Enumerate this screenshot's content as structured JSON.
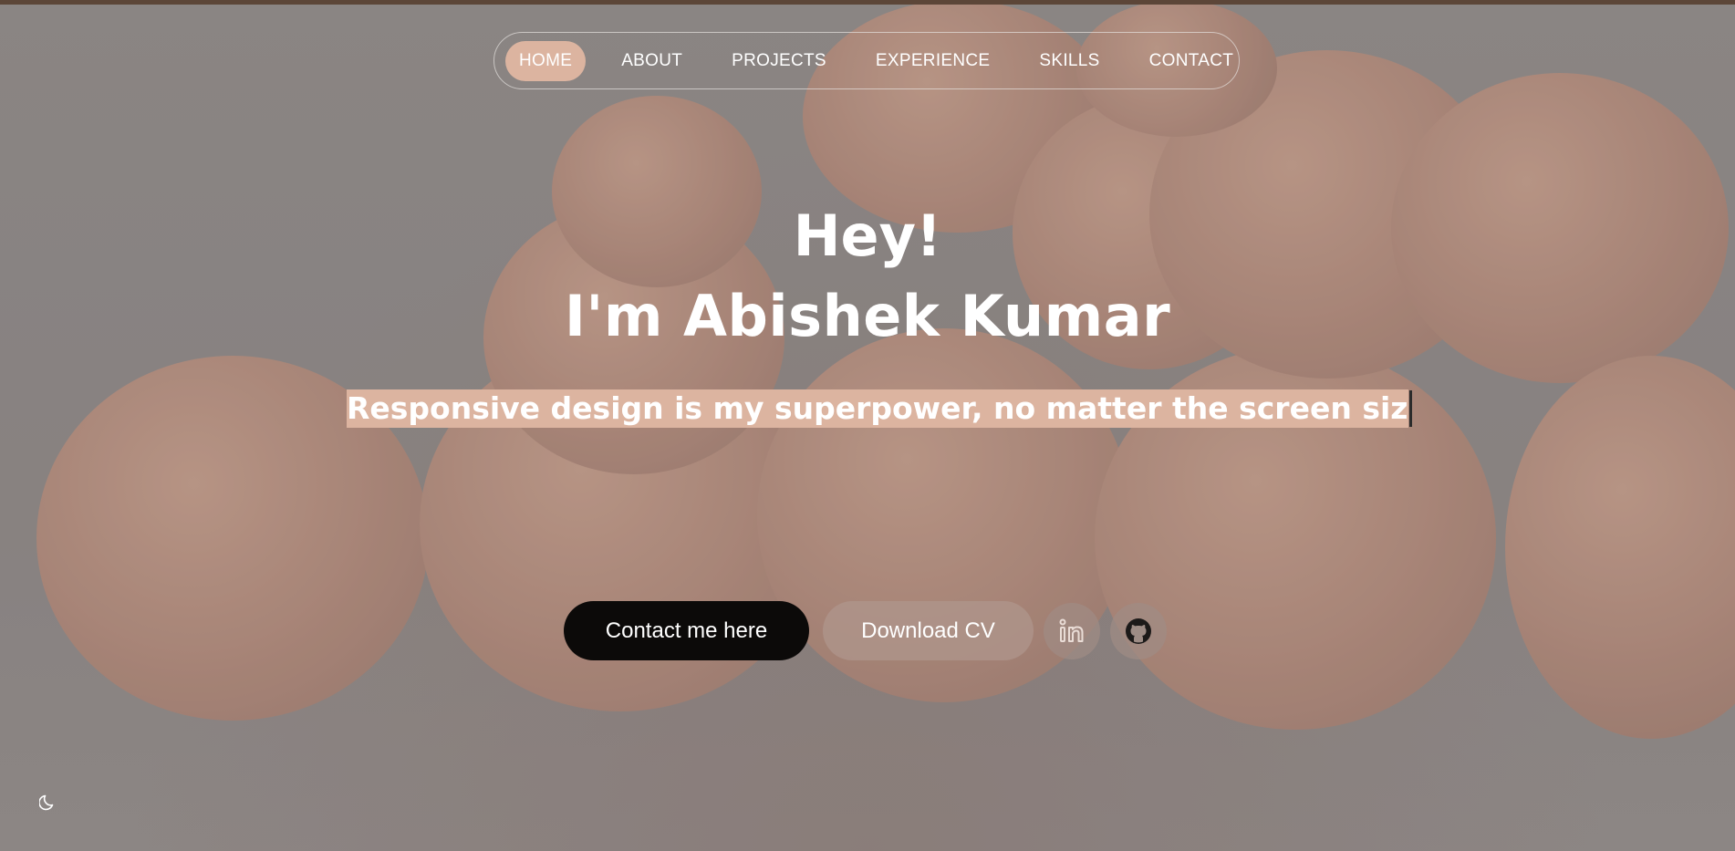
{
  "nav": {
    "items": [
      {
        "label": "HOME",
        "active": true
      },
      {
        "label": "ABOUT",
        "active": false
      },
      {
        "label": "PROJECTS",
        "active": false
      },
      {
        "label": "EXPERIENCE",
        "active": false
      },
      {
        "label": "SKILLS",
        "active": false
      },
      {
        "label": "CONTACT",
        "active": false
      }
    ]
  },
  "hero": {
    "greeting": "Hey!",
    "name_line": "I'm Abishek Kumar",
    "tagline": "Responsive design is my superpower, no matter the screen siz"
  },
  "actions": {
    "contact_label": "Contact me here",
    "download_cv_label": "Download CV",
    "linkedin_icon": "linkedin-icon",
    "github_icon": "github-icon"
  },
  "theme_toggle": {
    "icon": "moon-icon"
  },
  "colors": {
    "accent": "#dcb4a0",
    "primary_button": "#0c0a09",
    "top_strip": "#5c4638"
  }
}
